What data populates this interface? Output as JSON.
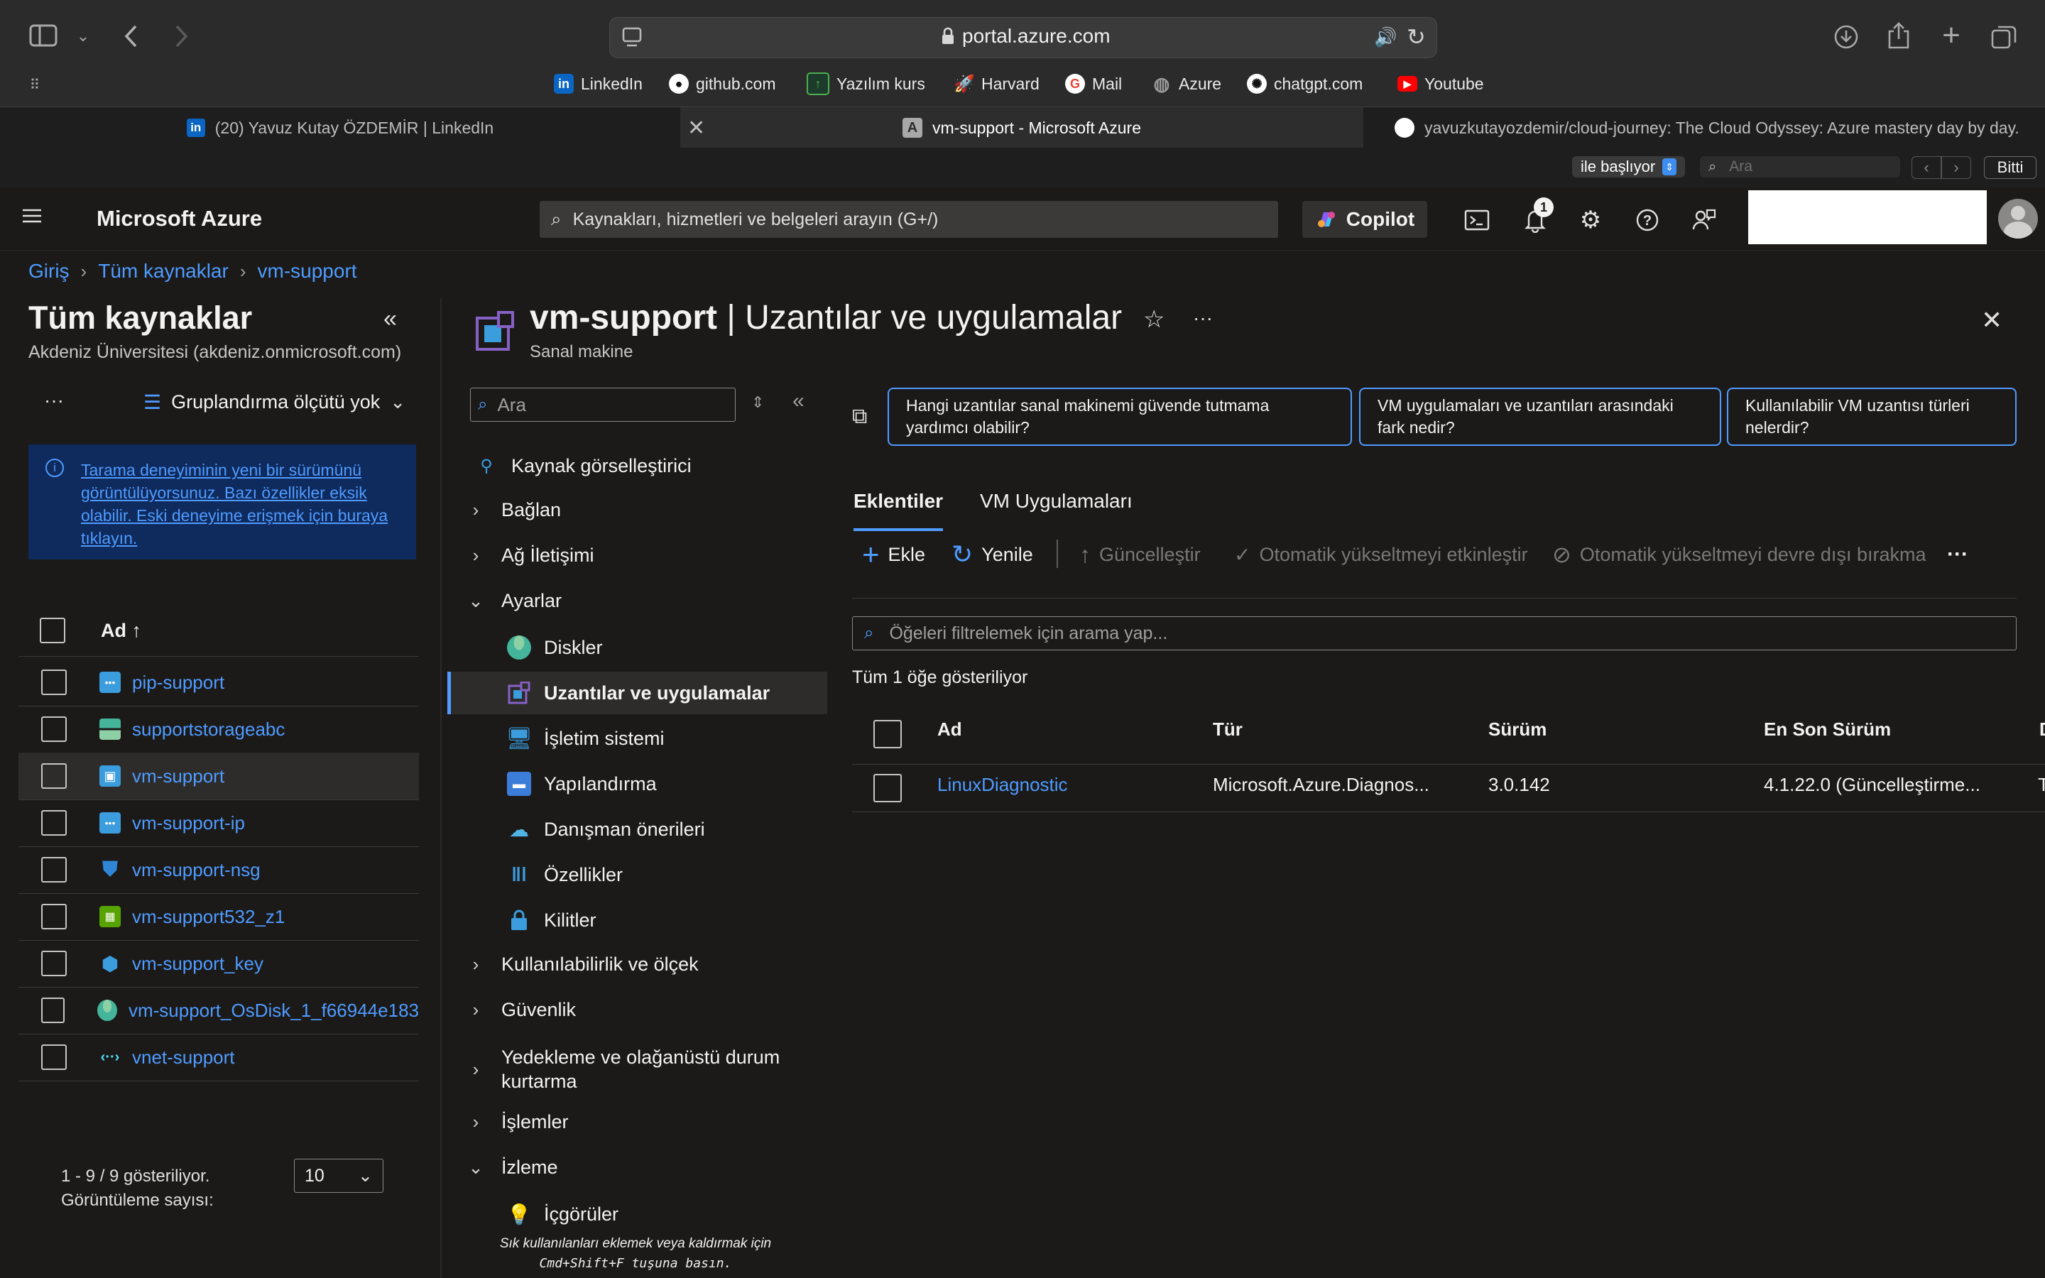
{
  "browser": {
    "url": "portal.azure.com",
    "favorites": [
      {
        "label": "LinkedIn",
        "icon": "linkedin-icon",
        "color": "#0a66c2"
      },
      {
        "label": "github.com",
        "icon": "github-icon",
        "color": "#ffffff"
      },
      {
        "label": "Yazılım kurs",
        "icon": "bookmark-icon",
        "color": "#2e7d32"
      },
      {
        "label": "Harvard",
        "icon": "rocket-icon",
        "color": "#e07a2c"
      },
      {
        "label": "Mail",
        "icon": "google-icon",
        "color": "#ea4335"
      },
      {
        "label": "Azure",
        "icon": "globe-icon",
        "color": "#9a9a9a"
      },
      {
        "label": "chatgpt.com",
        "icon": "openai-icon",
        "color": "#ffffff"
      },
      {
        "label": "Youtube",
        "icon": "youtube-icon",
        "color": "#ff0000"
      }
    ],
    "tabs": [
      {
        "label": "(20) Yavuz Kutay ÖZDEMİR | LinkedIn"
      },
      {
        "label": "vm-support - Microsoft Azure"
      },
      {
        "label": "yavuzkutayozdemir/cloud-journey: The Cloud Odyssey: Azure mastery day by day."
      }
    ],
    "find": {
      "mode": "ile başlıyor",
      "placeholder": "Ara",
      "done": "Bitti"
    }
  },
  "azure": {
    "brand": "Microsoft Azure",
    "search_placeholder": "Kaynakları, hizmetleri ve belgeleri arayın (G+/)",
    "copilot": "Copilot",
    "notifications_count": "1"
  },
  "breadcrumb": [
    "Giriş",
    "Tüm kaynaklar",
    "vm-support"
  ],
  "left": {
    "title": "Tüm kaynaklar",
    "subtitle": "Akdeniz Üniversitesi (akdeniz.onmicrosoft.com)",
    "more": "···",
    "grouping": "Gruplandırma ölçütü yok",
    "info": "Tarama deneyiminin yeni bir sürümünü görüntülüyorsunuz. Bazı özellikler eksik olabilir. Eski deneyime erişmek için buraya tıklayın.",
    "column_name": "Ad ↑",
    "rows": [
      {
        "name": "pip-support",
        "icon": "public-ip-icon",
        "color": "#3b9cde"
      },
      {
        "name": "supportstorageabc",
        "icon": "storage-account-icon",
        "color": "#44b49b"
      },
      {
        "name": "vm-support",
        "icon": "virtual-machine-icon",
        "color": "#3b9cde"
      },
      {
        "name": "vm-support-ip",
        "icon": "public-ip-icon",
        "color": "#3b9cde"
      },
      {
        "name": "vm-support-nsg",
        "icon": "shield-icon",
        "color": "#2f86d6"
      },
      {
        "name": "vm-support532_z1",
        "icon": "network-interface-icon",
        "color": "#57a300"
      },
      {
        "name": "vm-support_key",
        "icon": "ssh-key-icon",
        "color": "#3b9cde"
      },
      {
        "name": "vm-support_OsDisk_1_f66944e183",
        "icon": "disk-icon",
        "color": "#44b49b"
      },
      {
        "name": "vnet-support",
        "icon": "vnet-icon",
        "color": "#50e6ff"
      }
    ],
    "paging": "1 - 9 / 9 gösteriliyor.",
    "page_size_label": "Görüntüleme sayısı:",
    "page_size": "10"
  },
  "blade": {
    "resource": "vm-support",
    "title_suffix": " | Uzantılar ve uygulamalar",
    "subtitle": "Sanal makine",
    "nav_search_placeholder": "Ara",
    "nav": [
      {
        "label": "Kaynak görselleştirici",
        "kind": "item",
        "icon": "resource-visualizer-icon"
      },
      {
        "label": "Bağlan",
        "kind": "group-collapsed"
      },
      {
        "label": "Ağ İletişimi",
        "kind": "group-collapsed"
      },
      {
        "label": "Ayarlar",
        "kind": "group-expanded"
      },
      {
        "label": "Diskler",
        "kind": "child",
        "icon": "disk-icon"
      },
      {
        "label": "Uzantılar ve uygulamalar",
        "kind": "child-active",
        "icon": "extensions-icon"
      },
      {
        "label": "İşletim sistemi",
        "kind": "child",
        "icon": "monitor-icon"
      },
      {
        "label": "Yapılandırma",
        "kind": "child",
        "icon": "toolbox-icon"
      },
      {
        "label": "Danışman önerileri",
        "kind": "child",
        "icon": "advisor-icon"
      },
      {
        "label": "Özellikler",
        "kind": "child",
        "icon": "properties-icon"
      },
      {
        "label": "Kilitler",
        "kind": "child",
        "icon": "lock-icon"
      },
      {
        "label": "Kullanılabilirlik ve ölçek",
        "kind": "group-collapsed"
      },
      {
        "label": "Güvenlik",
        "kind": "group-collapsed"
      },
      {
        "label": "Yedekleme ve olağanüstü durum kurtarma",
        "kind": "group-collapsed"
      },
      {
        "label": "İşlemler",
        "kind": "group-collapsed"
      },
      {
        "label": "İzleme",
        "kind": "group-expanded"
      },
      {
        "label": "İçgörüler",
        "kind": "child",
        "icon": "lightbulb-icon"
      }
    ],
    "nav_tip": "Sık kullanılanları eklemek veya kaldırmak için",
    "nav_tip_keys": "Cmd+Shift+F tuşuna basın.",
    "prompts": [
      "Hangi uzantılar sanal makinemi güvende tutmama yardımcı olabilir?",
      "VM uygulamaları ve uzantıları arasındaki fark nedir?",
      "Kullanılabilir VM uzantısı türleri nelerdir?"
    ],
    "tabs": [
      "Eklentiler",
      "VM Uygulamaları"
    ],
    "toolbar": {
      "add": "Ekle",
      "refresh": "Yenile",
      "update": "Güncelleştir",
      "enable_auto": "Otomatik yükseltmeyi etkinleştir",
      "disable_auto": "Otomatik yükseltmeyi devre dışı bırakma",
      "more": "···"
    },
    "filter_placeholder": "Öğeleri filtrelemek için arama yap...",
    "count_text": "Tüm 1 öğe gösteriliyor",
    "columns": [
      "Ad",
      "Tür",
      "Sürüm",
      "En Son Sürüm",
      "D"
    ],
    "rows": [
      {
        "name": "LinuxDiagnostic",
        "type": "Microsoft.Azure.Diagnos...",
        "version": "3.0.142",
        "latest": "4.1.22.0 (Güncelleştirme...",
        "extra": "T"
      }
    ]
  }
}
